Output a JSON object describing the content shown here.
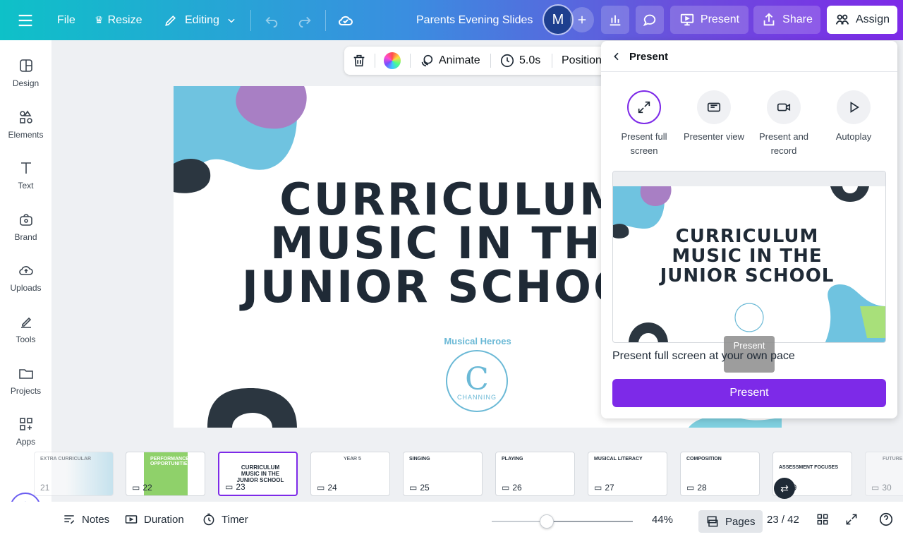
{
  "header": {
    "file_label": "File",
    "resize_label": "Resize",
    "editing_label": "Editing",
    "doc_title": "Parents Evening Slides",
    "avatar_initial": "M",
    "present_label": "Present",
    "share_label": "Share",
    "assign_label": "Assign"
  },
  "sidebar": {
    "items": [
      {
        "label": "Design",
        "icon": "design-icon"
      },
      {
        "label": "Elements",
        "icon": "elements-icon"
      },
      {
        "label": "Text",
        "icon": "text-icon"
      },
      {
        "label": "Brand",
        "icon": "brand-icon"
      },
      {
        "label": "Uploads",
        "icon": "uploads-icon"
      },
      {
        "label": "Tools",
        "icon": "tools-icon"
      },
      {
        "label": "Projects",
        "icon": "folder-icon"
      },
      {
        "label": "Apps",
        "icon": "apps-icon"
      }
    ]
  },
  "element_toolbar": {
    "animate_label": "Animate",
    "duration_label": "5.0s",
    "position_label": "Position"
  },
  "slide": {
    "title_lines": [
      "CURRICULUM",
      "MUSIC IN THE",
      "JUNIOR SCHOOL"
    ],
    "logo_arc_text": "Musical Heroes",
    "logo_letter": "C",
    "logo_caption": "CHANNING"
  },
  "present_panel": {
    "back_title": "Present",
    "options": [
      {
        "label": "Present full screen",
        "icon": "fullscreen-icon",
        "selected": true
      },
      {
        "label": "Presenter view",
        "icon": "presenter-view-icon",
        "selected": false
      },
      {
        "label": "Present and record",
        "icon": "record-icon",
        "selected": false
      },
      {
        "label": "Autoplay",
        "icon": "play-icon",
        "selected": false
      }
    ],
    "preview_title_lines": [
      "CURRICULUM",
      "MUSIC IN THE",
      "JUNIOR SCHOOL"
    ],
    "tooltip": "Present",
    "description": "Present full screen at your own pace",
    "present_button": "Present",
    "accent": "#7d2ae8"
  },
  "filmstrip": {
    "pages": [
      {
        "num": "21",
        "title": "EXTRA CURRICULAR"
      },
      {
        "num": "22",
        "title": "PERFORMANCE OPPORTUNITIES"
      },
      {
        "num": "23",
        "title": "CURRICULUM MUSIC IN THE JUNIOR SCHOOL",
        "active": true
      },
      {
        "num": "24",
        "title": "YEAR 5"
      },
      {
        "num": "25",
        "title": "SINGING"
      },
      {
        "num": "26",
        "title": "PLAYING"
      },
      {
        "num": "27",
        "title": "MUSICAL LITERACY"
      },
      {
        "num": "28",
        "title": "COMPOSITION"
      },
      {
        "num": "29",
        "title": "ASSESSMENT FOCUSES"
      },
      {
        "num": "30",
        "title": "FUTURE"
      }
    ]
  },
  "footer": {
    "notes_label": "Notes",
    "duration_label": "Duration",
    "timer_label": "Timer",
    "zoom": "44%",
    "zoom_level": 0.44,
    "pages_label": "Pages",
    "page_counter": "23 / 42"
  }
}
